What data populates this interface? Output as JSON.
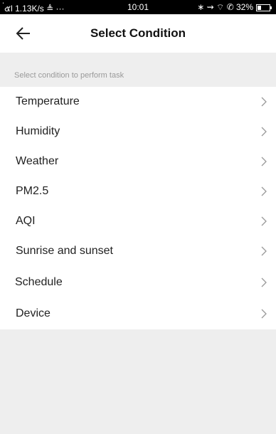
{
  "status_bar": {
    "left": "่๕l 1.13K/s ≜ ···",
    "time": "10:01",
    "right": "∗ ⇝ ⌔ ✆ 32%",
    "battery_percent": 32
  },
  "header": {
    "back_icon": "arrow-left-icon",
    "title": "Select Condition"
  },
  "section": {
    "label": "Select condition to perform task"
  },
  "conditions": [
    {
      "label": "Temperature",
      "icon": "chevron-right-icon"
    },
    {
      "label": "Humidity",
      "icon": "chevron-right-icon"
    },
    {
      "label": "Weather",
      "icon": "chevron-right-icon"
    },
    {
      "label": "PM2.5",
      "icon": "chevron-right-icon"
    },
    {
      "label": "AQI",
      "icon": "chevron-right-icon"
    },
    {
      "label": "Sunrise and sunset",
      "icon": "chevron-right-icon"
    },
    {
      "label": "Schedule",
      "icon": "chevron-right-icon"
    },
    {
      "label": "Device",
      "icon": "chevron-right-icon"
    }
  ],
  "colors": {
    "background_gray": "#eeeeee",
    "chevron": "#999999",
    "title": "#111111"
  }
}
